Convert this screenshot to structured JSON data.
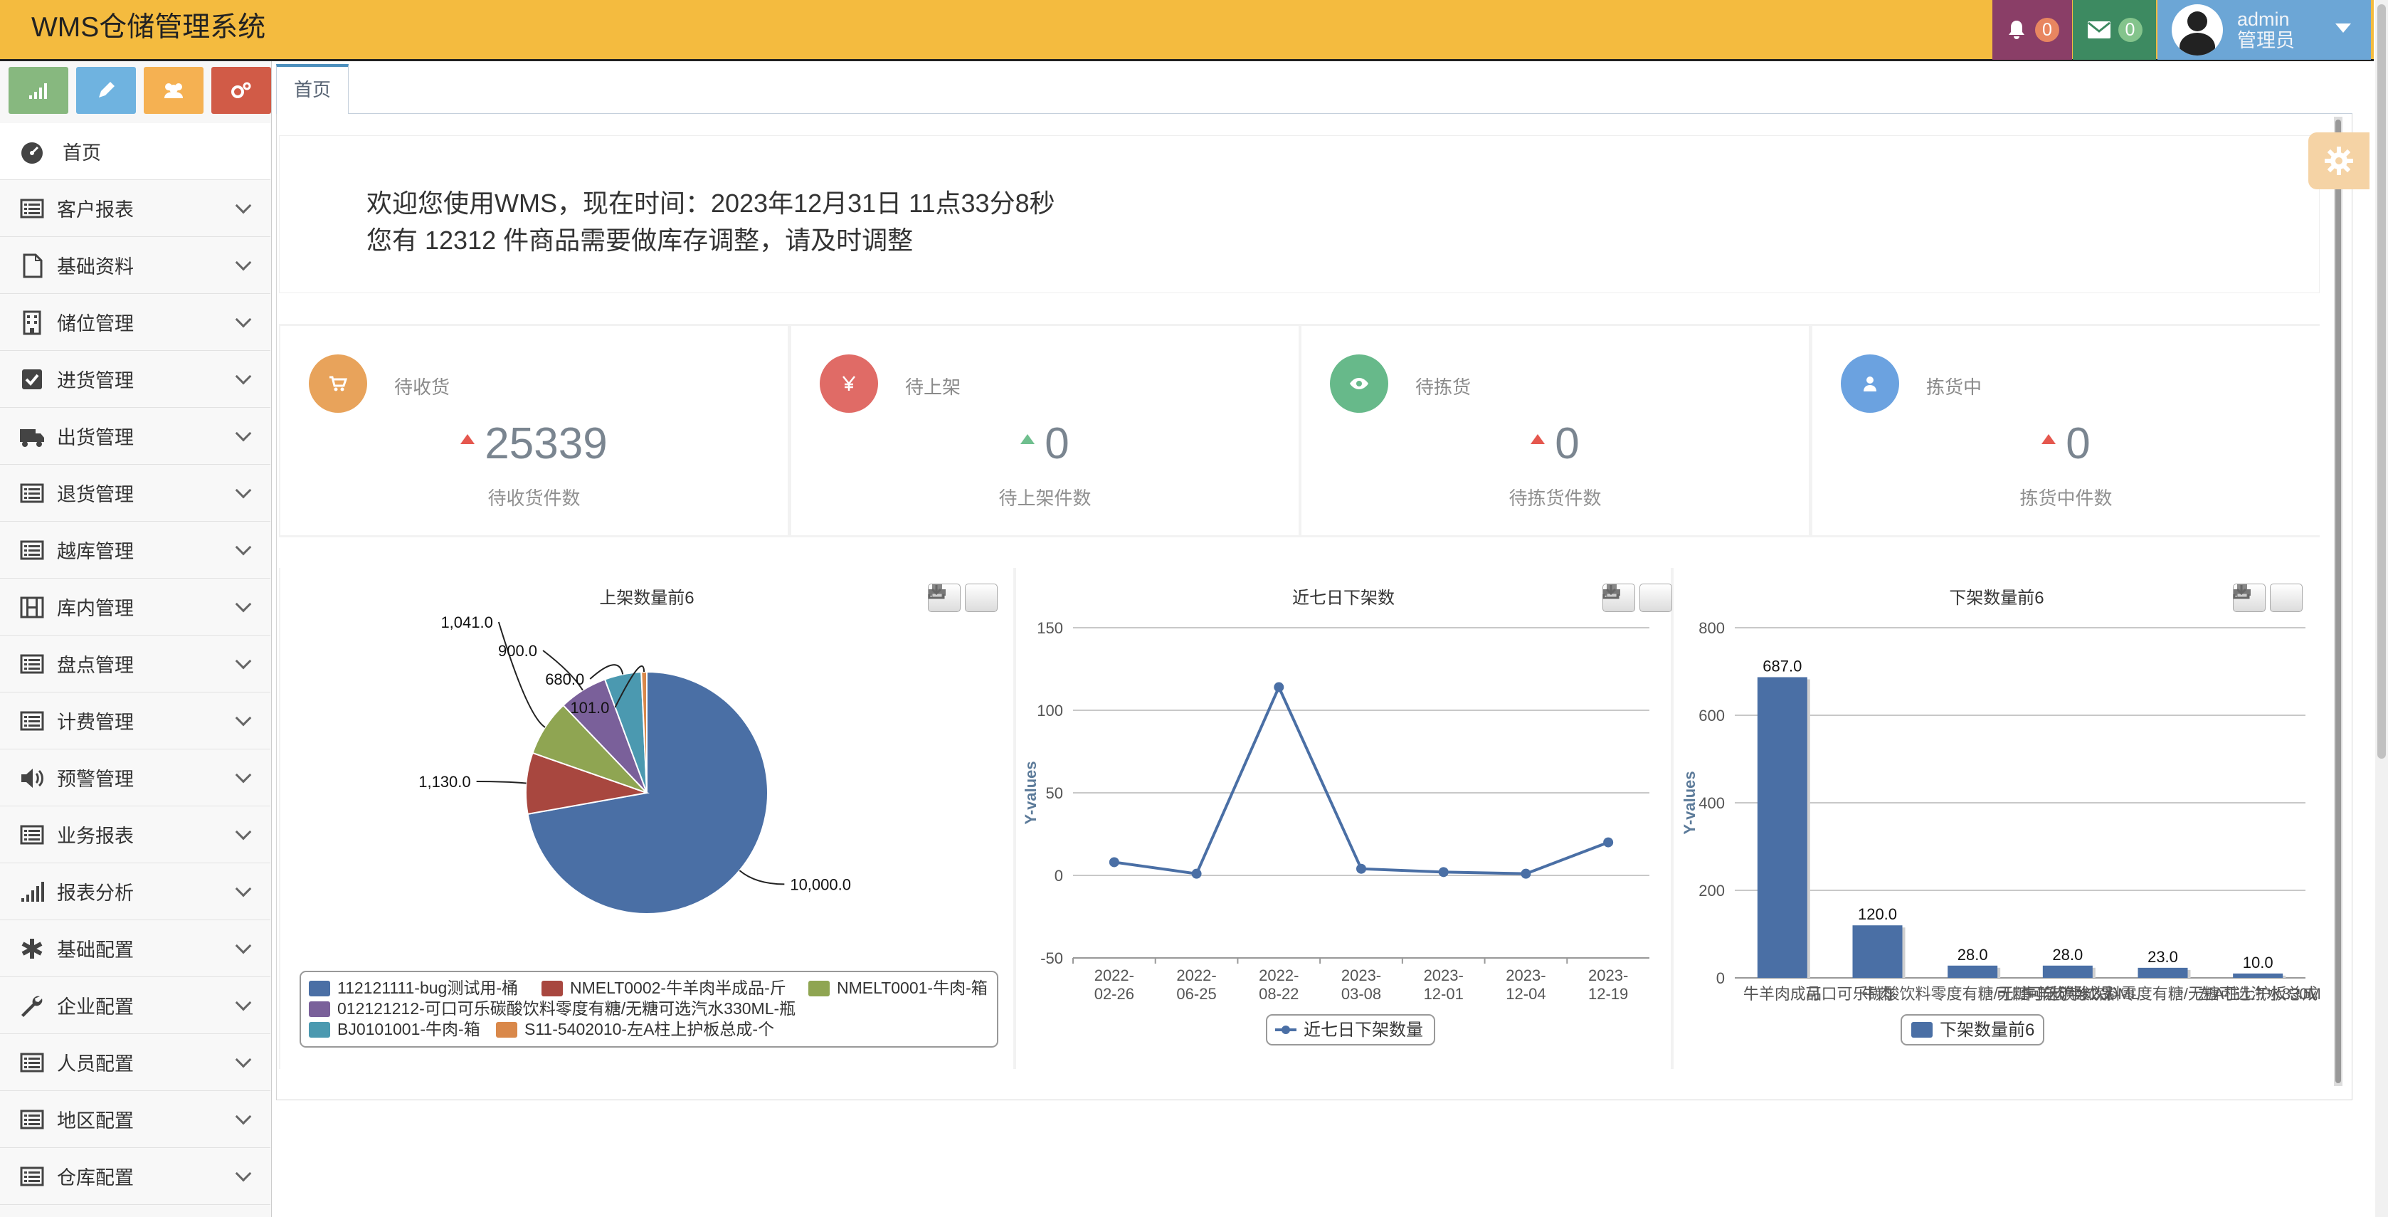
{
  "app": {
    "title": "WMS仓储管理系统"
  },
  "header": {
    "notifications": {
      "icon": "bell-icon",
      "count": "0"
    },
    "messages": {
      "icon": "envelope-icon",
      "count": "0"
    },
    "user": {
      "name": "admin",
      "role": "管理员"
    }
  },
  "shortcuts": [
    {
      "icon": "signal-icon",
      "color": "#87b87f"
    },
    {
      "icon": "pencil-icon",
      "color": "#6fb3e0"
    },
    {
      "icon": "users-icon",
      "color": "#f5b152"
    },
    {
      "icon": "cogs-icon",
      "color": "#d15b47"
    }
  ],
  "sidebar": {
    "items": [
      {
        "label": "首页",
        "icon": "dashboard-icon"
      },
      {
        "label": "客户报表",
        "icon": "list-icon"
      },
      {
        "label": "基础资料",
        "icon": "file-icon"
      },
      {
        "label": "储位管理",
        "icon": "building-icon"
      },
      {
        "label": "进货管理",
        "icon": "check-square-icon"
      },
      {
        "label": "出货管理",
        "icon": "truck-icon"
      },
      {
        "label": "退货管理",
        "icon": "list-icon"
      },
      {
        "label": "越库管理",
        "icon": "list-icon"
      },
      {
        "label": "库内管理",
        "icon": "film-icon"
      },
      {
        "label": "盘点管理",
        "icon": "list-icon"
      },
      {
        "label": "计费管理",
        "icon": "list-icon"
      },
      {
        "label": "预警管理",
        "icon": "volume-icon"
      },
      {
        "label": "业务报表",
        "icon": "list-icon"
      },
      {
        "label": "报表分析",
        "icon": "signal-icon"
      },
      {
        "label": "基础配置",
        "icon": "asterisk-icon"
      },
      {
        "label": "企业配置",
        "icon": "wrench-icon"
      },
      {
        "label": "人员配置",
        "icon": "list-icon"
      },
      {
        "label": "地区配置",
        "icon": "list-icon"
      },
      {
        "label": "仓库配置",
        "icon": "list-icon"
      }
    ]
  },
  "tabs": [
    {
      "label": "首页"
    }
  ],
  "welcome": {
    "line1": "欢迎您使用WMS，现在时间：2023年12月31日 11点33分8秒",
    "line2": "您有 12312 件商品需要做库存调整，请及时调整"
  },
  "stats": [
    {
      "title": "待收货",
      "value": "25339",
      "sub": "待收货件数",
      "icon": "cart-icon",
      "color": "#e8a35b",
      "arrow_color": "#e5574e"
    },
    {
      "title": "待上架",
      "value": "0",
      "sub": "待上架件数",
      "icon": "yen-icon",
      "color": "#e06b66",
      "arrow_color": "#6fbf8e"
    },
    {
      "title": "待拣货",
      "value": "0",
      "sub": "待拣货件数",
      "icon": "eye-icon",
      "color": "#67b98a",
      "arrow_color": "#e5574e"
    },
    {
      "title": "拣货中",
      "value": "0",
      "sub": "拣货中件数",
      "icon": "user-icon",
      "color": "#6ba2e0",
      "arrow_color": "#e5574e"
    }
  ],
  "chart_data": [
    {
      "type": "pie",
      "title": "上架数量前6",
      "slices": [
        {
          "label": "112121111-bug测试用-桶",
          "value": 10000.0,
          "value_label": "10,000.0",
          "color": "#4a6fa5"
        },
        {
          "label": "NMELT0002-牛羊肉半成品-斤",
          "value": 1130.0,
          "value_label": "1,130.0",
          "color": "#a8473f"
        },
        {
          "label": "NMELT0001-牛肉-箱",
          "value": 1041.0,
          "value_label": "1,041.0",
          "color": "#8fa552"
        },
        {
          "label": "012121212-可口可乐碳酸饮料零度有糖/无糖可选汽水330ML-瓶",
          "value": 900.0,
          "value_label": "900.0",
          "color": "#7a609a"
        },
        {
          "label": "BJ0101001-牛肉-箱",
          "value": 680.0,
          "value_label": "680.0",
          "color": "#4b99b0"
        },
        {
          "label": "S11-5402010-左A柱上护板总成-个",
          "value": 101.0,
          "value_label": "101.0",
          "color": "#d9884a"
        }
      ]
    },
    {
      "type": "line",
      "title": "近七日下架数",
      "xlabel": "",
      "ylabel": "Y-values",
      "categories": [
        "2022-02-26",
        "2022-06-25",
        "2022-08-22",
        "2023-03-08",
        "2023-12-01",
        "2023-12-04",
        "2023-12-19"
      ],
      "yticks": [
        "150",
        "100",
        "50",
        "0",
        "-50"
      ],
      "ylim": [
        -50,
        150
      ],
      "series": [
        {
          "name": "近七日下架数量",
          "values": [
            8,
            1,
            114,
            4,
            2,
            1,
            20
          ],
          "color": "#4a6fa5"
        }
      ]
    },
    {
      "type": "bar",
      "title": "下架数量前6",
      "xlabel": "",
      "ylabel": "Y-values",
      "categories": [
        "牛羊肉成品",
        "牛肉",
        "可口可乐碳酸饮料零度有糖/无糖可选汽水330ML",
        "牛羊肉半成品",
        "可口可乐碳酸饮料零度有糖/无糖可选汽水330ML",
        "左A柱上护板总成"
      ],
      "yticks": [
        "800",
        "600",
        "400",
        "200",
        "0"
      ],
      "ylim": [
        0,
        800
      ],
      "series": [
        {
          "name": "下架数量前6",
          "values": [
            687.0,
            120.0,
            28.0,
            28.0,
            23.0,
            10.0
          ],
          "value_labels": [
            "687.0",
            "120.0",
            "28.0",
            "28.0",
            "23.0",
            "10.0"
          ],
          "color": "#4a6fa5"
        }
      ]
    }
  ]
}
